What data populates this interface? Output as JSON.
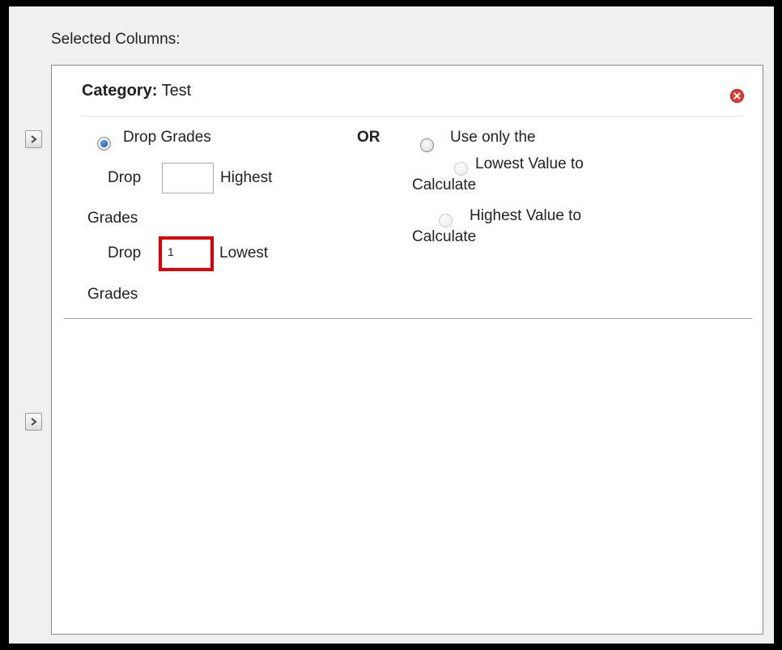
{
  "section_label": "Selected Columns:",
  "category": {
    "label": "Category:",
    "name": "Test"
  },
  "drop_grades": {
    "option_label": "Drop Grades",
    "drop_label": "Drop",
    "highest_label": "Highest",
    "highest_value": "",
    "grades_label": "Grades",
    "lowest_label": "Lowest",
    "lowest_value": "1"
  },
  "or_label": "OR",
  "use_only": {
    "option_label": "Use only the",
    "lowest_label": "Lowest Value to",
    "highest_label": "Highest Value to",
    "calculate_label": "Calculate"
  },
  "icons": {
    "expand": "chevron-right-icon",
    "remove": "remove-circle-icon"
  },
  "colors": {
    "highlight": "#e00000",
    "remove": "#e23a2e",
    "radio_selected": "#0b4f9e"
  }
}
